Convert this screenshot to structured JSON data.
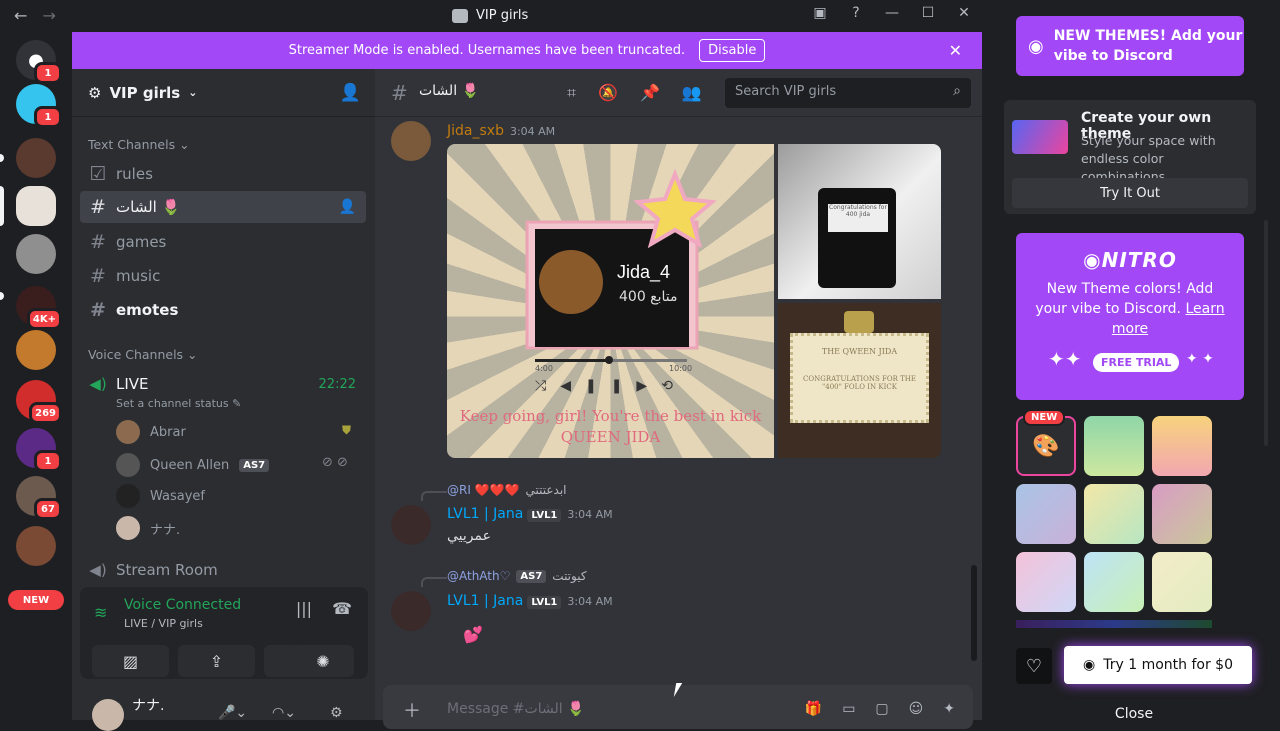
{
  "titlebar": {
    "title": "VIP girls",
    "back": "←",
    "forward": "→"
  },
  "banner": {
    "text": "Streamer Mode is enabled. Usernames have been truncated.",
    "button": "Disable"
  },
  "guilds": {
    "badges": [
      "1",
      "1",
      "4K+",
      "269",
      "1",
      "67"
    ],
    "new_label": "NEW"
  },
  "server": {
    "name": "VIP girls"
  },
  "categories": {
    "text": "Text Channels",
    "voice": "Voice Channels"
  },
  "text_channels": [
    {
      "name": "rules"
    },
    {
      "name": "الشات 🌷"
    },
    {
      "name": "games"
    },
    {
      "name": "music"
    },
    {
      "name": "emotes"
    }
  ],
  "voice_channel": {
    "name": "LIVE",
    "timer": "22:22",
    "status": "Set a channel status"
  },
  "voice_users": [
    {
      "name": "Abrar"
    },
    {
      "name": "Queen Allen",
      "tag": "AS7"
    },
    {
      "name": "Wasayef"
    },
    {
      "name": "ナナ."
    }
  ],
  "stream_room": {
    "name": "Stream Room"
  },
  "voice_panel": {
    "title": "Voice Connected",
    "subtitle": "LIVE / VIP girls"
  },
  "user": {
    "name": "ナナ."
  },
  "chat": {
    "channel": "الشات 🌷",
    "search_placeholder": "Search VIP girls",
    "composer_placeholder": "Message #الشات 🌷"
  },
  "messages": [
    {
      "author": "Jida_sxb",
      "time": "3:04 AM",
      "author_color": "#c27c0e"
    },
    {
      "reply_name": "ابدعتتتي",
      "reply_mention": "@RI ❤️❤️❤️",
      "author": "LVL1 | Jana",
      "level": "LVL1",
      "time": "3:04 AM",
      "text": "عمرييي"
    },
    {
      "reply_name": "كيوتتت",
      "reply_mention": "@AthAth♡",
      "reply_tag": "AS7",
      "author": "LVL1 | Jana",
      "level": "LVL1",
      "time": "3:04 AM",
      "text": "💕"
    }
  ],
  "image_card": {
    "name": "Jida_4",
    "followers": "400 متابع",
    "time_start": "4:00",
    "time_end": "10:00",
    "caption": "Keep going, girl! You're the best in kick QUEEN JIDA",
    "cert_title": "THE QWEEN JIDA",
    "cert_text": "CONGRATULATIONS FOR THE \"400\" FOLO IN KICK",
    "note_text": "Congratulations for 400 jida"
  },
  "sidebar": {
    "promo": "NEW THEMES! Add your vibe to Discord",
    "theme_title": "Create your own theme",
    "theme_desc": "Style your space with endless color combinations.",
    "try_label": "Try It Out",
    "nitro_logo": "NITRO",
    "nitro_text": "New Theme colors! Add your vibe to Discord.",
    "learn_more": "Learn more",
    "free_trial": "FREE TRIAL",
    "new_chip": "NEW",
    "try_month": "Try 1 month for $0",
    "close": "Close"
  },
  "colors": {
    "accent": "#a248f7",
    "green": "#23a55a",
    "red": "#f23f43",
    "link": "#00a8fc"
  }
}
